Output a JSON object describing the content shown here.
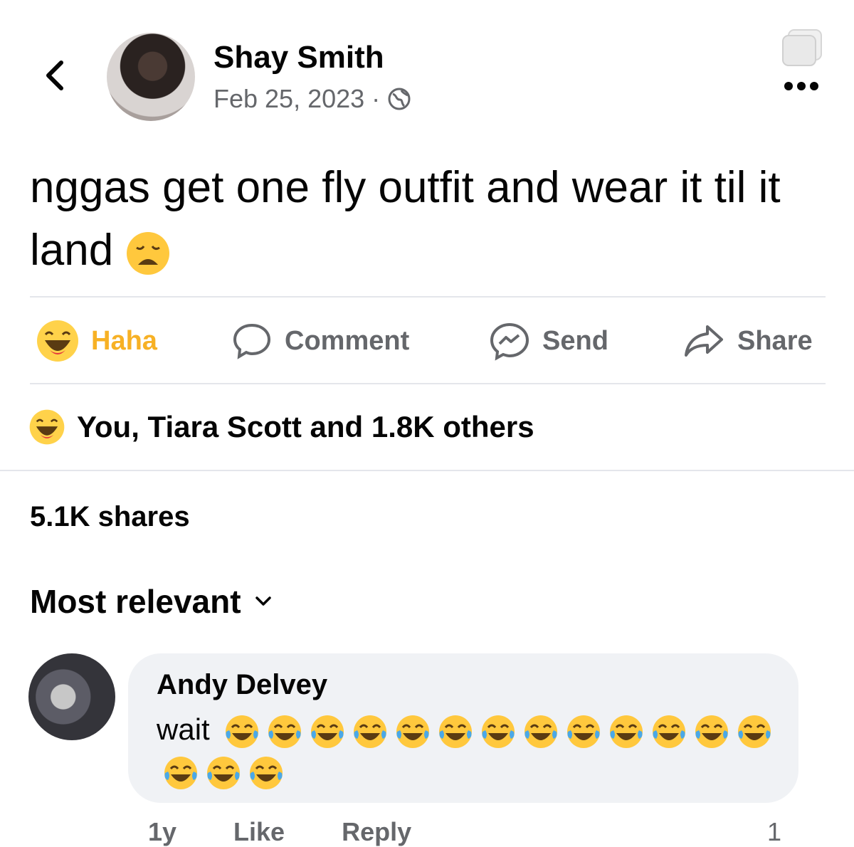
{
  "post": {
    "author": "Shay Smith",
    "date": "Feb 25, 2023",
    "separator": "·",
    "audience_icon": "globe-icon",
    "text": "nggas get one fly outfit and wear it til it land",
    "text_emoji": "weary-face"
  },
  "actions": {
    "haha": "Haha",
    "comment": "Comment",
    "send": "Send",
    "share": "Share"
  },
  "reactions_summary": "You, Tiara Scott and 1.8K others",
  "shares": "5.1K shares",
  "sort_label": "Most relevant",
  "comments": [
    {
      "author": "Andy Delvey",
      "text": "wait",
      "emoji": "face-with-tears-of-joy",
      "emoji_count": 16,
      "time": "1y",
      "like": "Like",
      "reply": "Reply",
      "reaction_count": "1"
    }
  ],
  "colors": {
    "accent_haha": "#f7b125",
    "muted": "#65676b",
    "bubble": "#f0f2f5"
  }
}
